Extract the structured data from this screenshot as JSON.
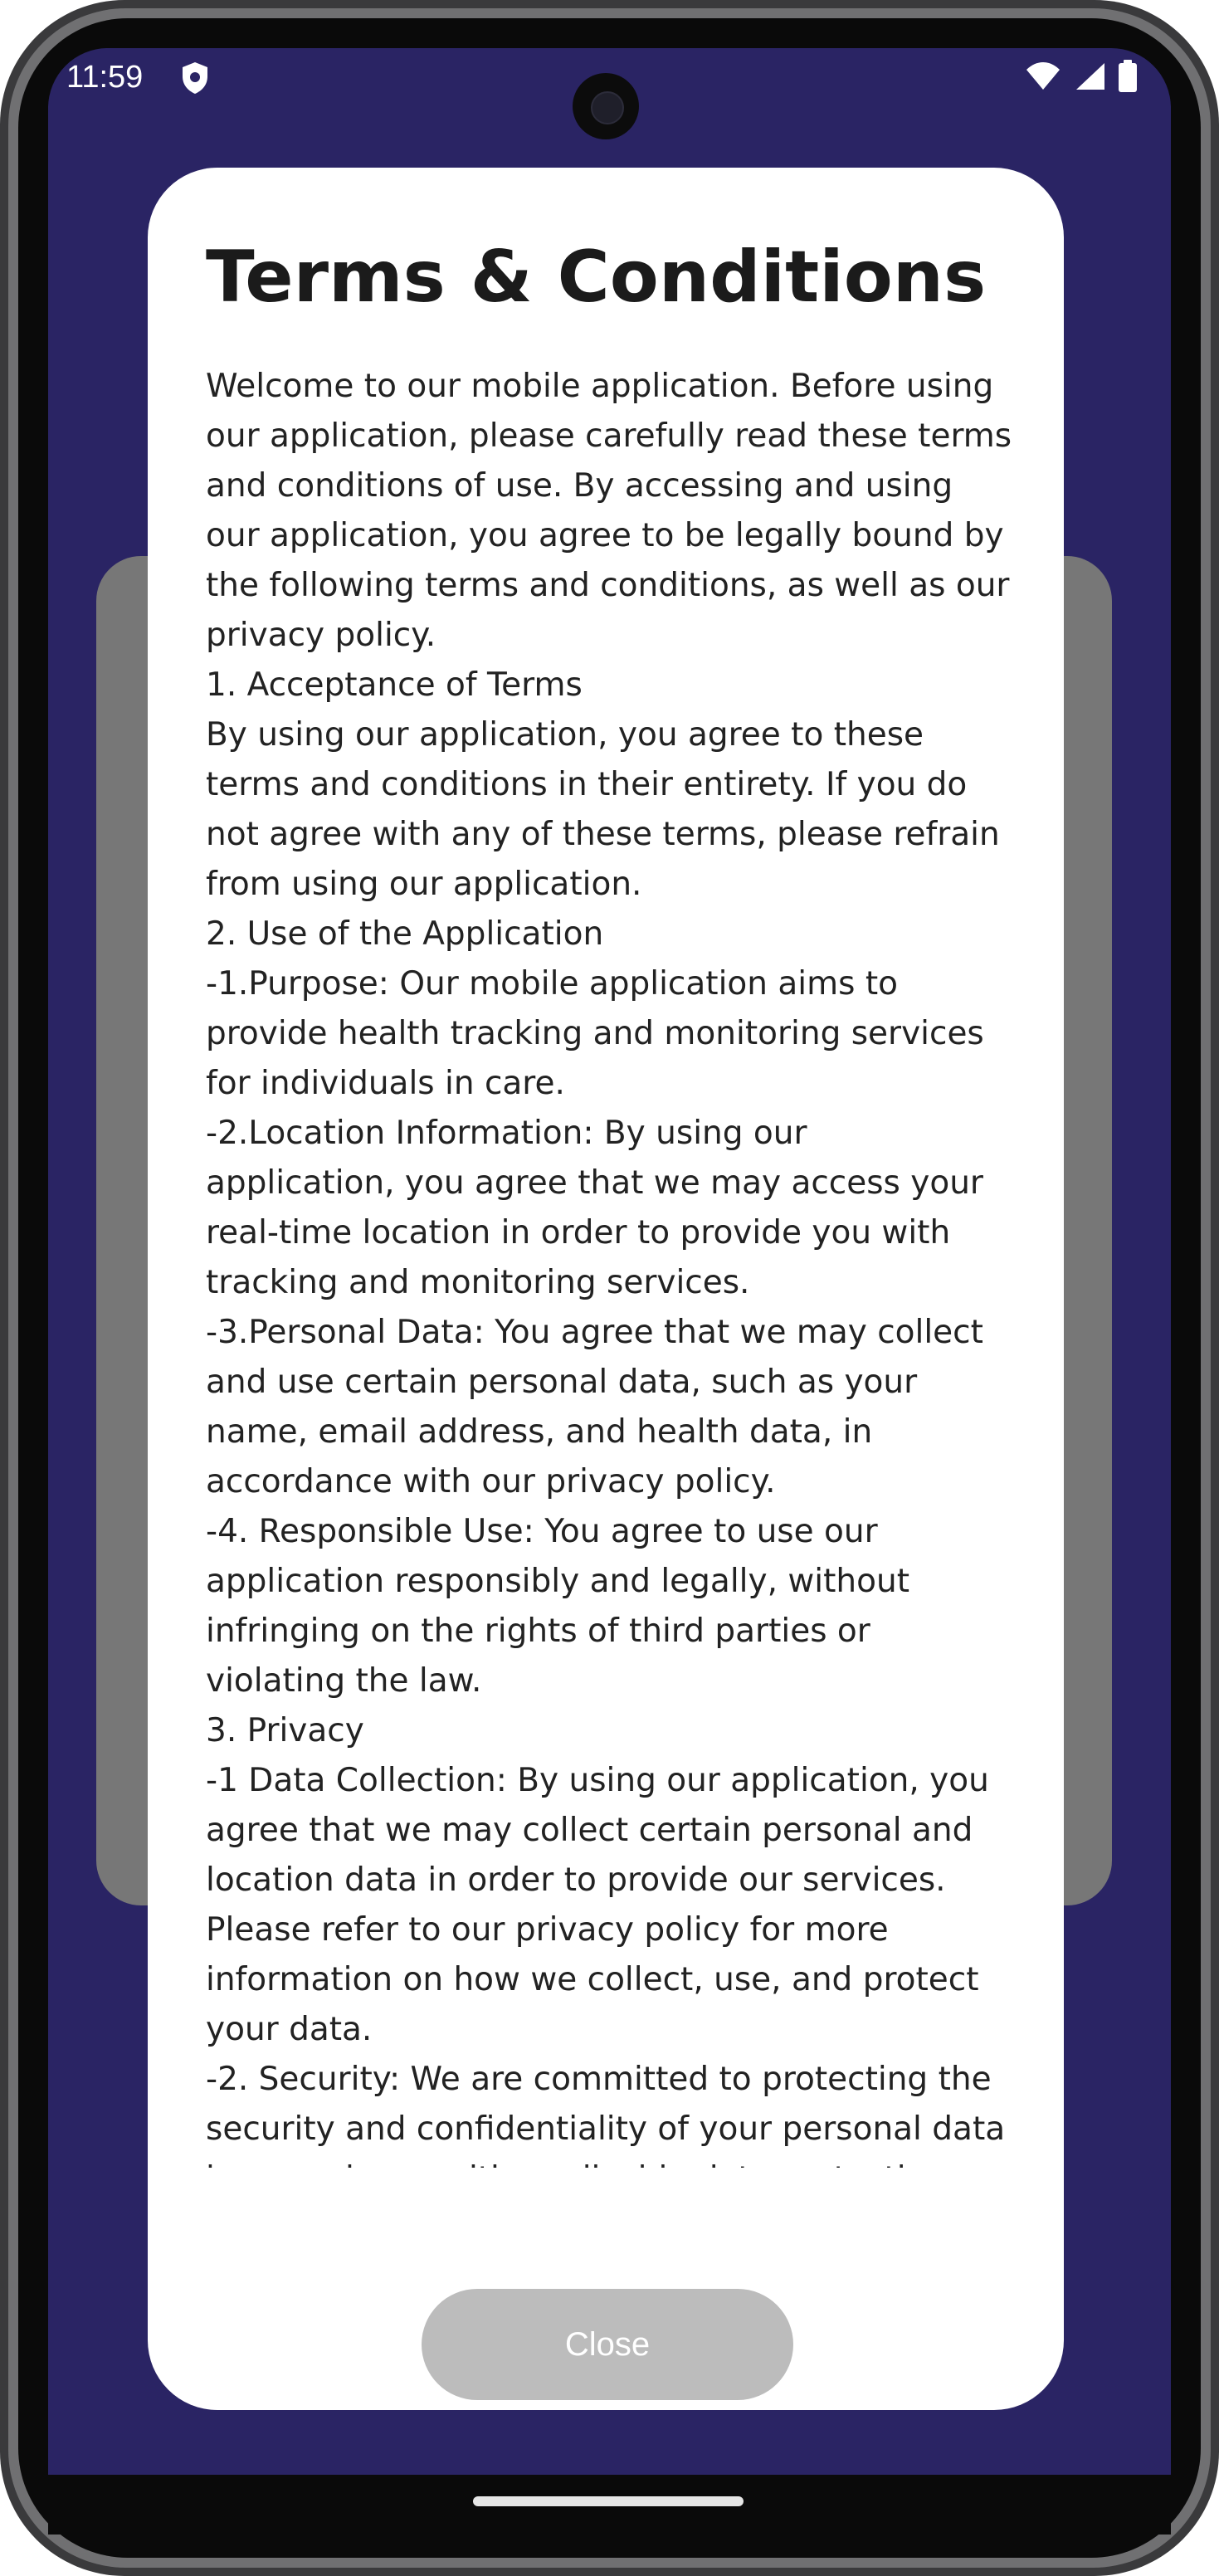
{
  "status_bar": {
    "time": "11:59"
  },
  "dialog": {
    "title": "Terms & Conditions",
    "lines": [
      "Welcome to our mobile application. Before using",
      "our application, please carefully read these terms",
      "and conditions of use. By accessing and using",
      "our application, you agree to be legally bound by",
      "the following terms and conditions, as well as our",
      "privacy policy.",
      "1. Acceptance of Terms",
      "By using our application, you agree to these",
      "terms and conditions in their entirety. If you do",
      "not agree with any of these terms, please refrain",
      "from using our application.",
      "2. Use of the Application",
      " -1.Purpose: Our mobile application aims to",
      "provide health tracking and monitoring services",
      "for individuals in care.",
      " -2.Location Information: By using our",
      "application, you agree that we may access your",
      "real-time location in order to provide you with",
      "tracking and monitoring services.",
      " -3.Personal Data: You agree that we may collect",
      "and use certain personal data, such as your",
      "name, email address, and health data, in",
      "accordance with our privacy policy.",
      " -4. Responsible Use: You agree to use our",
      "application responsibly and legally, without",
      "infringing on the rights of third parties or",
      "violating the law.",
      "3. Privacy",
      " -1 Data Collection: By using our application, you",
      "agree that we may collect certain personal and",
      "location data in order to provide our services.",
      "Please refer to our privacy policy for more",
      "information on how we collect, use, and protect",
      "your data.",
      " -2. Security: We are committed to protecting the",
      "security and confidentiality of your personal data",
      "in accordance with applicable data protection"
    ],
    "close_label": "Close"
  },
  "colors": {
    "screen_background": "#2a2464",
    "backdrop_card": "#777777",
    "dialog_background": "#ffffff",
    "close_button": "#bcbcbc"
  },
  "icons": [
    "shield-icon",
    "wifi-icon",
    "cellular-signal-icon",
    "battery-icon",
    "camera-icon"
  ]
}
